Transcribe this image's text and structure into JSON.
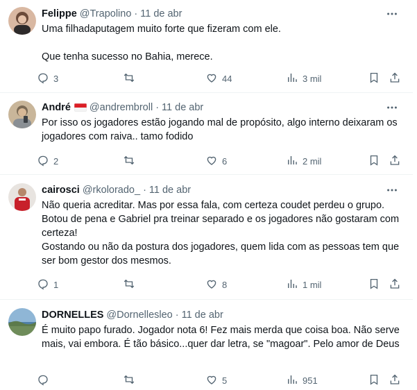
{
  "replies": [
    {
      "name": "Felippe",
      "handle": "@Trapolino",
      "dot": "·",
      "time": "11 de abr",
      "text": "Uma filhadaputagem muito forte que fizeram com ele.\n\nQue tenha sucesso no Bahia, merece.",
      "replies": "3",
      "reposts": "",
      "likes": "44",
      "views": "3 mil",
      "avatar_colors": [
        "#6b4b3a",
        "#d9b8a2"
      ]
    },
    {
      "name": "André",
      "has_flag": true,
      "handle": "@andrembroll",
      "dot": "·",
      "time": "11 de abr",
      "text": "Por isso os jogadores estão jogando mal de propósito, algo interno deixaram os jogadores com raiva.. tamo fodido",
      "replies": "2",
      "reposts": "",
      "likes": "6",
      "views": "2 mil",
      "avatar_colors": [
        "#7a6a55",
        "#c9b69a"
      ]
    },
    {
      "name": "cairosci",
      "handle": "@rkolorado_",
      "dot": "·",
      "time": "11 de abr",
      "text": "Não queria acreditar. Mas por essa fala, com certeza coudet perdeu o grupo. Botou de pena e Gabriel pra treinar separado e os jogadores não gostaram com certeza!\nGostando ou não da postura dos jogadores, quem lida com as pessoas tem que ser bom gestor dos mesmos.",
      "replies": "1",
      "reposts": "",
      "likes": "8",
      "views": "1 mil",
      "avatar_colors": [
        "#c8202a",
        "#e8e4e0"
      ]
    },
    {
      "name": "DORNELLES",
      "handle": "@Dornellesleo",
      "dot": "·",
      "time": "11 de abr",
      "text": "É muito papo furado. Jogador nota 6! Fez mais merda que coisa boa. Não serve mais, vai embora. É tão básico...quer dar letra, se \"magoar\". Pelo amor de Deus",
      "replies": "",
      "reposts": "",
      "likes": "5",
      "views": "951",
      "avatar_colors": [
        "#8fb6d6",
        "#6f8c5a"
      ]
    }
  ],
  "colors": {
    "text": "#0f1419",
    "muted": "#536471",
    "divider": "#eff3f4",
    "flag_red": "#dc1f26"
  },
  "icons": [
    "more-icon",
    "reply-icon",
    "repost-icon",
    "like-icon",
    "views-icon",
    "bookmark-icon",
    "share-icon"
  ]
}
